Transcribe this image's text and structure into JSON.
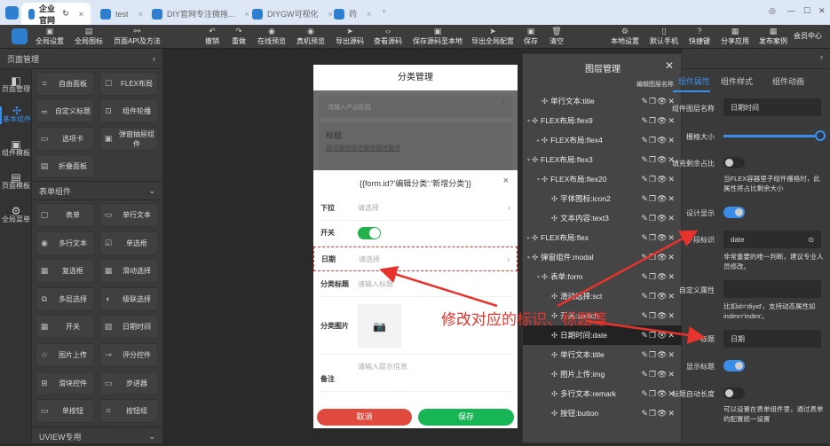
{
  "tabs": [
    {
      "label": "企业官网",
      "active": true
    },
    {
      "label": "test"
    },
    {
      "label": "DIY官网专注微拖..."
    },
    {
      "label": "DIYGW可视化"
    },
    {
      "label": "药"
    }
  ],
  "window_controls": {
    "settings": "◎",
    "minimize": "—",
    "maximize": "☐",
    "close": "✕"
  },
  "toolbar": {
    "left": [
      {
        "label": "全局设置",
        "icon": "▣"
      },
      {
        "label": "全局图标",
        "icon": "▤"
      },
      {
        "label": "页面API及方法",
        "icon": "⚯"
      }
    ],
    "center": [
      {
        "label": "撤销",
        "icon": "↶"
      },
      {
        "label": "重做",
        "icon": "↷"
      },
      {
        "label": "在线预览",
        "icon": "◉"
      },
      {
        "label": "真机预览",
        "icon": "◉"
      },
      {
        "label": "导出源码",
        "icon": "➤"
      },
      {
        "label": "查看源码",
        "icon": "‹›"
      },
      {
        "label": "保存源码至本地",
        "icon": "▣"
      },
      {
        "label": "导出全局配置",
        "icon": "➤"
      },
      {
        "label": "保存",
        "icon": "▣"
      },
      {
        "label": "清空",
        "icon": "🗑"
      }
    ],
    "right": [
      {
        "label": "本地设置",
        "icon": "⚙"
      },
      {
        "label": "默认手机",
        "icon": "▯"
      },
      {
        "label": "快捷键",
        "icon": "?"
      },
      {
        "label": "分享应用",
        "icon": "▦"
      },
      {
        "label": "发布案例",
        "icon": "▦"
      }
    ],
    "member": "会员中心"
  },
  "left_panel": {
    "title": "页面管理",
    "rail": [
      "页面管理",
      "基本组件",
      "组件模板",
      "页面模板",
      "全局菜单"
    ],
    "basic": [
      "自由面板",
      "FLEX布局",
      "自定义标题",
      "组件轮播",
      "选项卡",
      "弹窗抽屉组件",
      "折叠面板"
    ],
    "form_section": "表单组件",
    "form": [
      "表单",
      "单行文本",
      "多行文本",
      "单选框",
      "复选框",
      "滑动选择",
      "多层选择",
      "级联选择",
      "开关",
      "日期时间",
      "图片上传",
      "评分控件",
      "滑块控件",
      "步进器",
      "单按钮",
      "按钮组"
    ],
    "uview_section": "UVIEW专用"
  },
  "phone": {
    "header": "分类管理",
    "search_placeholder": "请输入产品标题",
    "card_title": "标题",
    "card_desc": "描述描述描述描述描述描述",
    "modal_title": "{{form.id?'编辑分类':'新增分类'}}",
    "rows": [
      {
        "label": "下拉",
        "value": "请选择"
      },
      {
        "label": "开关"
      },
      {
        "label": "日期",
        "value": "请选择"
      },
      {
        "label": "分类标题",
        "value": "请输入标题"
      },
      {
        "label": "分类图片"
      },
      {
        "label": "备注",
        "value": "请输入提示信息"
      }
    ],
    "cancel": "取消",
    "save": "保存",
    "switch_on": true
  },
  "layers": {
    "title": "图层管理",
    "edit_name": "编辑图层名称",
    "actions": "✎❐👁✕",
    "items": [
      {
        "label": "单行文本:title",
        "level": 1
      },
      {
        "label": "FLEX布局:flex9",
        "level": 0,
        "caret": "▾"
      },
      {
        "label": "FLEX布局:flex4",
        "level": 1,
        "caret": "▸"
      },
      {
        "label": "FLEX布局:flex3",
        "level": 0,
        "caret": "▾"
      },
      {
        "label": "FLEX布局:flex20",
        "level": 1,
        "caret": "▾"
      },
      {
        "label": "字体图标:icon2",
        "level": 2
      },
      {
        "label": "文本内容:text3",
        "level": 2
      },
      {
        "label": "FLEX布局:flex",
        "level": 0,
        "caret": "▸"
      },
      {
        "label": "弹窗组件:modal",
        "level": 0,
        "caret": "▾"
      },
      {
        "label": "表单:form",
        "level": 1,
        "caret": "▾"
      },
      {
        "label": "滑动选择:sct",
        "level": 2
      },
      {
        "label": "开关:switch",
        "level": 2
      },
      {
        "label": "日期时间:date",
        "level": 2,
        "selected": true
      },
      {
        "label": "单行文本:title",
        "level": 2
      },
      {
        "label": "图片上传:img",
        "level": 2
      },
      {
        "label": "多行文本:remark",
        "level": 2
      },
      {
        "label": "按钮:button",
        "level": 2
      }
    ]
  },
  "right_panel": {
    "tabs": [
      "组件属性",
      "组件样式",
      "组件动画"
    ],
    "active_tab": 0,
    "layer_name_label": "组件图层名称",
    "layer_name": "日期时间",
    "grid_label": "栅格大小",
    "grid_value": 1.0,
    "fill_label": "填充剩余占比",
    "fill_on": false,
    "fill_hint": "当FLEX容器里子组件栅格时，此属性将占比剩余大小",
    "design_label": "设计显示",
    "design_on": true,
    "field_label": "字段标识",
    "field_value": "date",
    "field_hint": "非常重要的唯一判断，建议专业人员修改。",
    "custom_label": "自定义属性",
    "custom_value": "",
    "custom_hint": "比如id='diyid'，支持动态属性如index='index'。",
    "title_label": "标题",
    "title_value": "日期",
    "show_title_label": "显示标题",
    "show_title_on": true,
    "auto_len_label": "标题自动长度",
    "auto_len_on": false,
    "auto_hint": "可以设置在表单组件里，通过表单的配置统一设置"
  },
  "annotation": {
    "text": "修改对应的标识、标题等",
    "color": "#e8322c"
  }
}
